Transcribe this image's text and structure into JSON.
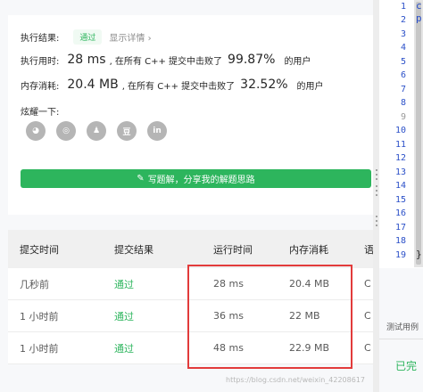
{
  "result": {
    "status_label": "执行结果:",
    "status_badge": "通过",
    "details_link": "显示详情",
    "details_chevron": "›",
    "runtime_label": "执行用时:",
    "runtime_value": "28 ms",
    "runtime_mid": ", 在所有 C++ 提交中击败了",
    "runtime_percent": "99.87%",
    "runtime_tail": "的用户",
    "memory_label": "内存消耗:",
    "memory_value": "20.4 MB",
    "memory_mid": ", 在所有 C++ 提交中击败了",
    "memory_percent": "32.52%",
    "memory_tail": "的用户",
    "share_label": "炫耀一下:",
    "share_icons": [
      {
        "name": "wechat-icon",
        "glyph": "◕"
      },
      {
        "name": "weibo-icon",
        "glyph": "◎"
      },
      {
        "name": "qq-icon",
        "glyph": "♟"
      },
      {
        "name": "douban-icon",
        "glyph": "豆"
      },
      {
        "name": "linkedin-icon",
        "glyph": "in"
      }
    ],
    "write_button": "写题解，分享我的解题思路",
    "write_icon": "✎"
  },
  "table": {
    "headers": [
      "提交时间",
      "提交结果",
      "运行时间",
      "内存消耗",
      "语"
    ],
    "rows": [
      {
        "time": "几秒前",
        "result": "通过",
        "runtime": "28 ms",
        "memory": "20.4 MB",
        "lang": "C"
      },
      {
        "time": "1 小时前",
        "result": "通过",
        "runtime": "36 ms",
        "memory": "22 MB",
        "lang": "C"
      },
      {
        "time": "1 小时前",
        "result": "通过",
        "runtime": "48 ms",
        "memory": "22.9 MB",
        "lang": "C"
      }
    ]
  },
  "editor": {
    "line_numbers": [
      "1",
      "2",
      "3",
      "4",
      "5",
      "6",
      "7",
      "8",
      "9",
      "10",
      "11",
      "12",
      "13",
      "14",
      "15",
      "16",
      "17",
      "18",
      "19"
    ],
    "frag_1": "c",
    "frag_2": "p",
    "frag_19": "}"
  },
  "bottom": {
    "test_tab": "测试用例",
    "done": "已完",
    "watermark": "https://blog.csdn.net/weixin_42208617"
  },
  "colors": {
    "accent_green": "#2db55d",
    "highlight_red": "#e23b3b",
    "line_number_blue": "#2b50c8"
  }
}
